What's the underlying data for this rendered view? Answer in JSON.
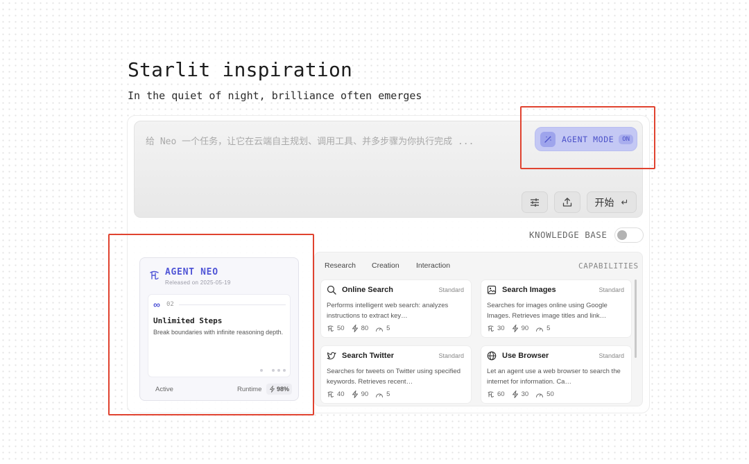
{
  "hero": {
    "title": "Starlit inspiration",
    "subtitle": "In the quiet of night, brilliance often emerges"
  },
  "prompt": {
    "placeholder": "给 Neo 一个任务，让它在云端自主规划、调用工具、并多步骤为你执行完成 ...",
    "agent_mode_label": "AGENT MODE",
    "agent_mode_state": "ON",
    "start_label": "开始",
    "start_key": "↵"
  },
  "knowledge_base": {
    "label": "KNOWLEDGE BASE",
    "enabled": false
  },
  "agent": {
    "name": "AGENT NEO",
    "release": "Released on 2025-05-19",
    "feature_symbol": "∞",
    "feature_index": "02",
    "feature_title": "Unlimited Steps",
    "feature_desc": "Break boundaries with infinite reasoning depth.",
    "status": "Active",
    "runtime_label": "Runtime",
    "runtime_value": "98%"
  },
  "capabilities": {
    "tabs": [
      "Research",
      "Creation",
      "Interaction"
    ],
    "header": "CAPABILITIES",
    "items": [
      {
        "icon": "search-icon",
        "name": "Online Search",
        "tier": "Standard",
        "desc": "Performs intelligent web search: analyzes instructions to extract key…",
        "stats": [
          "50",
          "80",
          "5"
        ]
      },
      {
        "icon": "image-icon",
        "name": "Search Images",
        "tier": "Standard",
        "desc": "Searches for images online using Google Images. Retrieves image titles and link…",
        "stats": [
          "30",
          "90",
          "5"
        ]
      },
      {
        "icon": "twitter-icon",
        "name": "Search Twitter",
        "tier": "Standard",
        "desc": "Searches for tweets on Twitter using specified keywords. Retrieves recent…",
        "stats": [
          "40",
          "90",
          "5"
        ]
      },
      {
        "icon": "globe-icon",
        "name": "Use Browser",
        "tier": "Standard",
        "desc": "Let an agent use a web browser to search the internet for information. Ca…",
        "stats": [
          "60",
          "30",
          "50"
        ]
      }
    ]
  },
  "colors": {
    "accent": "#5055d6",
    "agent_mode_bg": "#c4c8f4",
    "highlight": "#e0422f"
  }
}
